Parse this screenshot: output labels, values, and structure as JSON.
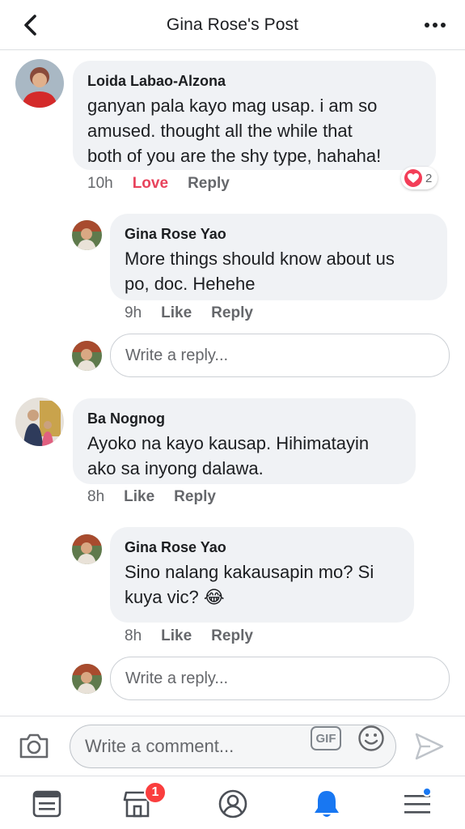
{
  "header": {
    "title": "Gina Rose's Post"
  },
  "comments": [
    {
      "author": "Loida Labao-Alzona",
      "text": "ganyan pala kayo mag usap. i am so\namused. thought all the while that\nboth of you are the shy type, hahaha!",
      "time": "10h",
      "reaction_label": "Love",
      "reply_label": "Reply",
      "reaction_count": "2"
    },
    {
      "author": "Gina Rose Yao",
      "text": "More things should know about us\npo, doc. Hehehe",
      "time": "9h",
      "like_label": "Like",
      "reply_label": "Reply"
    },
    {
      "author": "Ba Nognog",
      "text": "Ayoko na kayo kausap. Hihimatayin\nako sa inyong dalawa.",
      "time": "8h",
      "like_label": "Like",
      "reply_label": "Reply"
    },
    {
      "author": "Gina Rose Yao",
      "text": "Sino nalang kakausapin mo? Si\nkuya vic? 😂",
      "time": "8h",
      "like_label": "Like",
      "reply_label": "Reply"
    }
  ],
  "reply_placeholder": "Write a reply...",
  "comment_bar": {
    "placeholder": "Write a comment...",
    "gif_label": "GIF"
  },
  "nav": {
    "marketplace_badge": "1"
  },
  "colors": {
    "love": "#e8435c",
    "accent": "#1877f2",
    "badge": "#fa3e3e"
  }
}
